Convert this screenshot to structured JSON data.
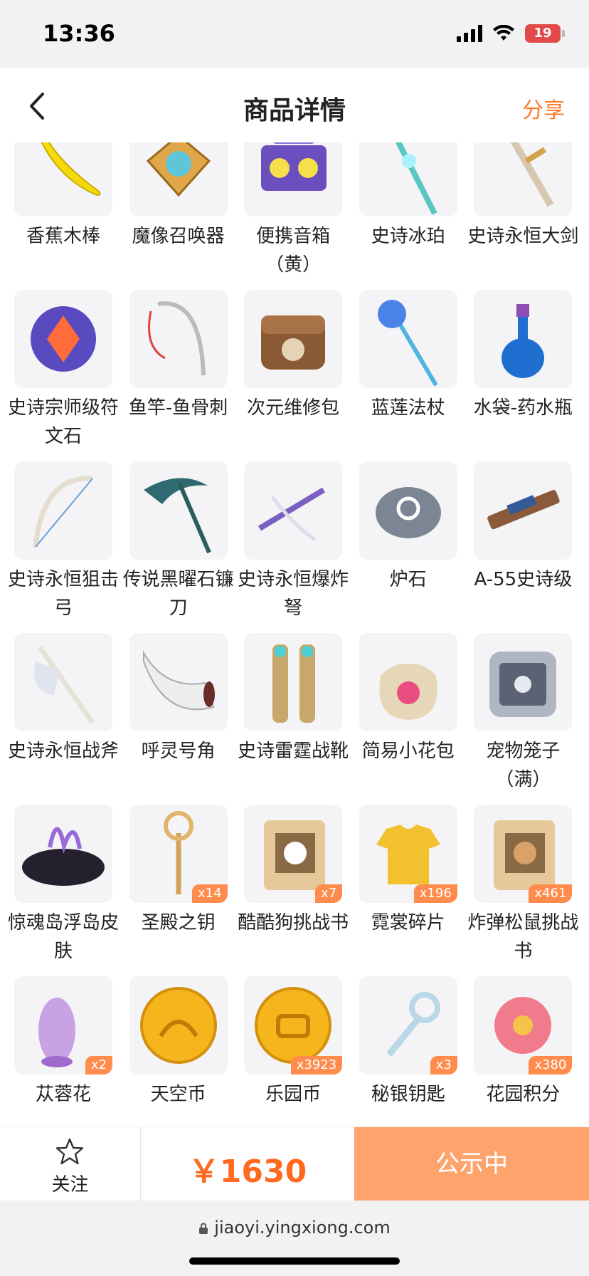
{
  "status_bar": {
    "time": "13:36",
    "battery": "19"
  },
  "nav": {
    "title": "商品详情",
    "share": "分享"
  },
  "items": [
    {
      "name": "香蕉木棒",
      "icon": "banana-club-icon",
      "qty": ""
    },
    {
      "name": "魔像召唤器",
      "icon": "golem-summoner-icon",
      "qty": ""
    },
    {
      "name": "便携音箱（黄）",
      "icon": "portable-speaker-icon",
      "qty": ""
    },
    {
      "name": "史诗冰珀",
      "icon": "ice-amber-staff-icon",
      "qty": ""
    },
    {
      "name": "史诗永恒大剑",
      "icon": "eternal-greatsword-icon",
      "qty": ""
    },
    {
      "name": "史诗宗师级符文石",
      "icon": "rune-stone-icon",
      "qty": ""
    },
    {
      "name": "鱼竿-鱼骨刺",
      "icon": "fishing-rod-icon",
      "qty": ""
    },
    {
      "name": "次元维修包",
      "icon": "repair-bag-icon",
      "qty": ""
    },
    {
      "name": "蓝莲法杖",
      "icon": "lotus-staff-icon",
      "qty": ""
    },
    {
      "name": "水袋-药水瓶",
      "icon": "potion-bottle-icon",
      "qty": ""
    },
    {
      "name": "史诗永恒狙击弓",
      "icon": "sniper-bow-icon",
      "qty": ""
    },
    {
      "name": "传说黑曜石镰刀",
      "icon": "obsidian-scythe-icon",
      "qty": ""
    },
    {
      "name": "史诗永恒爆炸弩",
      "icon": "explosive-crossbow-icon",
      "qty": ""
    },
    {
      "name": "炉石",
      "icon": "hearthstone-icon",
      "qty": ""
    },
    {
      "name": "A-55史诗级",
      "icon": "rifle-icon",
      "qty": ""
    },
    {
      "name": "史诗永恒战斧",
      "icon": "battle-axe-icon",
      "qty": ""
    },
    {
      "name": "呼灵号角",
      "icon": "horn-icon",
      "qty": ""
    },
    {
      "name": "史诗雷霆战靴",
      "icon": "thunder-boots-icon",
      "qty": ""
    },
    {
      "name": "简易小花包",
      "icon": "flower-bag-icon",
      "qty": ""
    },
    {
      "name": "宠物笼子（满）",
      "icon": "pet-cage-icon",
      "qty": ""
    },
    {
      "name": "惊魂岛浮岛皮肤",
      "icon": "floating-island-icon",
      "qty": ""
    },
    {
      "name": "圣殿之钥",
      "icon": "temple-key-icon",
      "qty": "x14"
    },
    {
      "name": "酷酷狗挑战书",
      "icon": "wanted-poster-dog-icon",
      "qty": "x7"
    },
    {
      "name": "霓裳碎片",
      "icon": "shirt-fragment-icon",
      "qty": "x196"
    },
    {
      "name": "炸弹松鼠挑战书",
      "icon": "wanted-poster-squirrel-icon",
      "qty": "x461"
    },
    {
      "name": "苁蓉花",
      "icon": "cistanche-flower-icon",
      "qty": "x2"
    },
    {
      "name": "天空币",
      "icon": "sky-coin-icon",
      "qty": ""
    },
    {
      "name": "乐园币",
      "icon": "park-coin-icon",
      "qty": "x3923"
    },
    {
      "name": "秘银钥匙",
      "icon": "mithril-key-icon",
      "qty": "x3"
    },
    {
      "name": "花园积分",
      "icon": "garden-points-icon",
      "qty": "x380"
    }
  ],
  "bottom": {
    "follow": "关注",
    "price": "￥1630",
    "status_button": "公示中"
  },
  "browser": {
    "url": "jiaoyi.yingxiong.com"
  },
  "colors": {
    "accent": "#ff6a1f",
    "button": "#ffa36d",
    "badge": "#ff8b4d"
  }
}
